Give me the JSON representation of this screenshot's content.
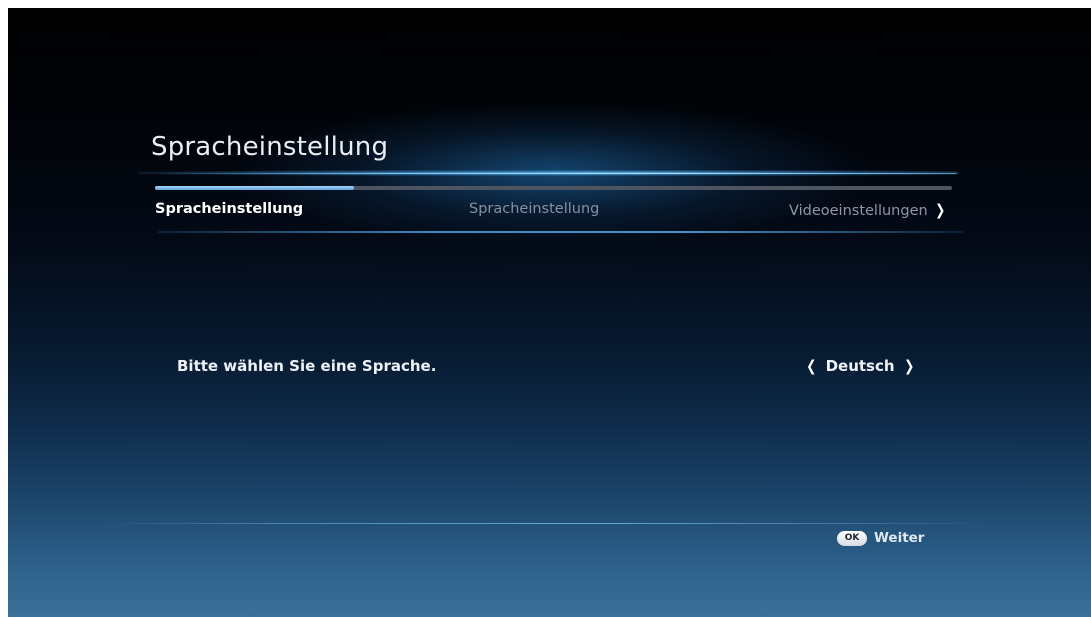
{
  "header": {
    "title": "Spracheinstellung"
  },
  "wizard": {
    "progress_percent": 25,
    "steps": [
      {
        "label": "Spracheinstellung",
        "state": "current"
      },
      {
        "label": "Spracheinstellung",
        "state": "upcoming"
      },
      {
        "label": "Videoeinstellungen",
        "state": "upcoming"
      }
    ],
    "next_icon": "chevron-right-icon"
  },
  "language": {
    "prompt": "Bitte wählen Sie eine Sprache.",
    "selected": "Deutsch",
    "prev_icon": "chevron-left-icon",
    "next_icon": "chevron-right-icon"
  },
  "footer": {
    "ok_badge": "OK",
    "action_label": "Weiter"
  },
  "colors": {
    "accent": "#5aa4dc",
    "text_primary": "#eef2f6",
    "text_inactive": "#8791a0"
  }
}
